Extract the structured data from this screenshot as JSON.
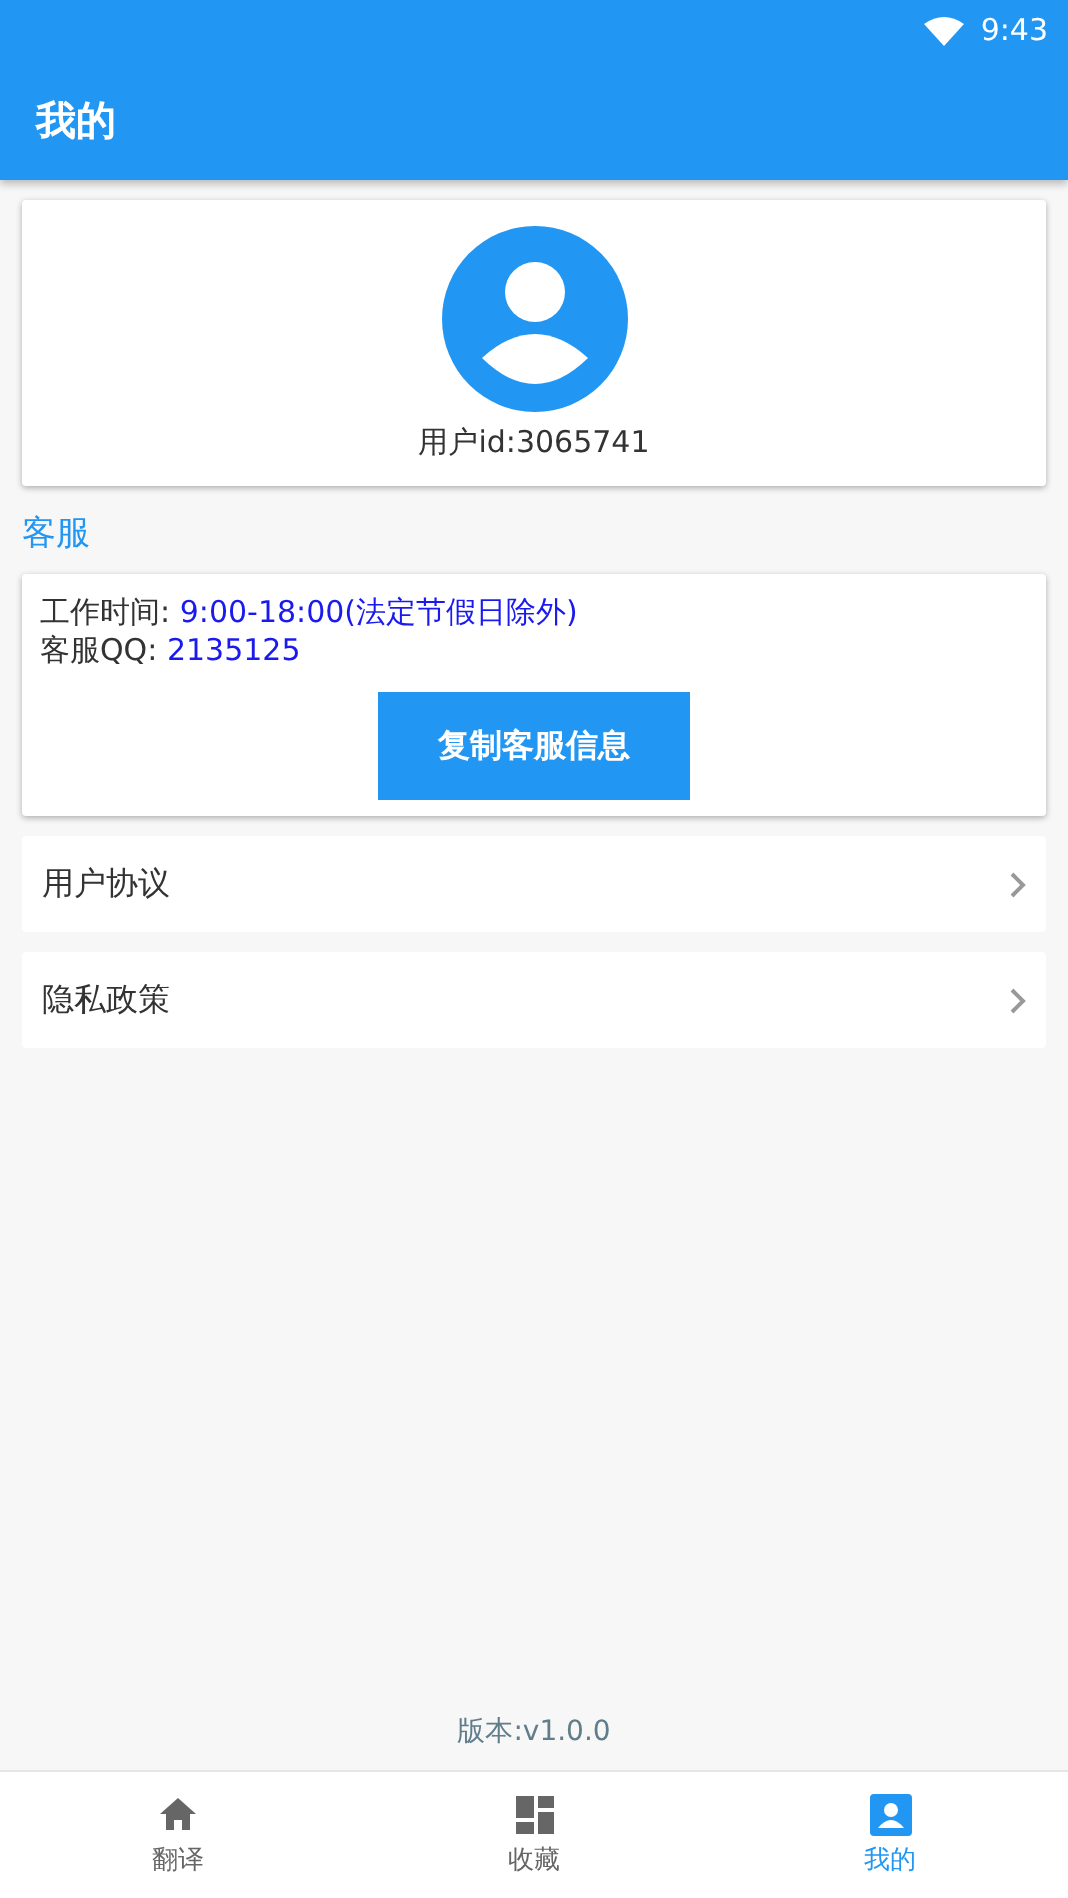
{
  "status_bar": {
    "time": "9:43"
  },
  "app_bar": {
    "title": "我的"
  },
  "profile": {
    "user_id": "用户id:3065741"
  },
  "section_title": "客服",
  "service": {
    "lines": [
      {
        "label": "工作时间:",
        "value": "9:00-18:00(法定节假日除外)"
      },
      {
        "label": "客服QQ:",
        "value": "2135125"
      }
    ],
    "button": "复制客服信息"
  },
  "links": [
    {
      "label": "用户协议"
    },
    {
      "label": "隐私政策"
    }
  ],
  "version": "版本:v1.0.0",
  "tabs": [
    {
      "label": "翻译",
      "kind": "home",
      "selected": false
    },
    {
      "label": "收藏",
      "kind": "dashboard",
      "selected": false
    },
    {
      "label": "我的",
      "kind": "profile",
      "selected": true
    }
  ]
}
